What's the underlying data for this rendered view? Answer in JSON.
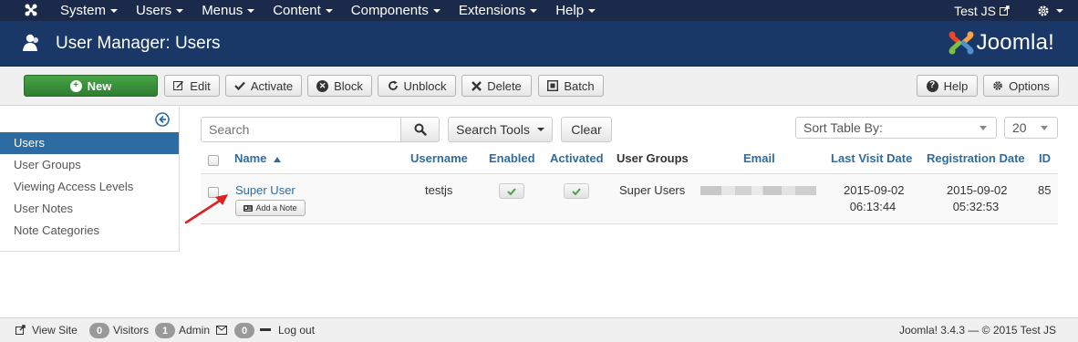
{
  "navbar": {
    "menu": [
      "System",
      "Users",
      "Menus",
      "Content",
      "Components",
      "Extensions",
      "Help"
    ],
    "user_name": "Test JS"
  },
  "header": {
    "title": "User Manager: Users",
    "brand": "Joomla!"
  },
  "toolbar": {
    "new": "New",
    "edit": "Edit",
    "activate": "Activate",
    "block": "Block",
    "unblock": "Unblock",
    "delete": "Delete",
    "batch": "Batch",
    "help": "Help",
    "options": "Options"
  },
  "sidebar": {
    "items": [
      "Users",
      "User Groups",
      "Viewing Access Levels",
      "User Notes",
      "Note Categories"
    ],
    "active_index": 0
  },
  "filters": {
    "search_placeholder": "Search",
    "search_tools": "Search Tools",
    "clear": "Clear",
    "sort_by": "Sort Table By:",
    "limit": "20"
  },
  "table": {
    "columns": {
      "name": "Name",
      "username": "Username",
      "enabled": "Enabled",
      "activated": "Activated",
      "groups": "User Groups",
      "email": "Email",
      "last_visit": "Last Visit Date",
      "registration": "Registration Date",
      "id": "ID"
    },
    "rows": [
      {
        "name": "Super User",
        "note_button": "Add a Note",
        "username": "testjs",
        "groups": "Super Users",
        "last_visit_date": "2015-09-02",
        "last_visit_time": "06:13:44",
        "registration_date": "2015-09-02",
        "registration_time": "05:32:53",
        "id": "85"
      }
    ]
  },
  "footer": {
    "view_site": "View Site",
    "visitors_count": "0",
    "visitors_label": "Visitors",
    "admin_count": "1",
    "admin_label": "Admin",
    "mail_count": "0",
    "logout": "Log out",
    "version": "Joomla! 3.4.3 — © 2015 Test JS"
  },
  "colors": {
    "navbar": "#1b2a4a",
    "header": "#1a3867",
    "accent": "#2d6ca2",
    "new_button": "#46a546",
    "arrow": "#e02020"
  }
}
